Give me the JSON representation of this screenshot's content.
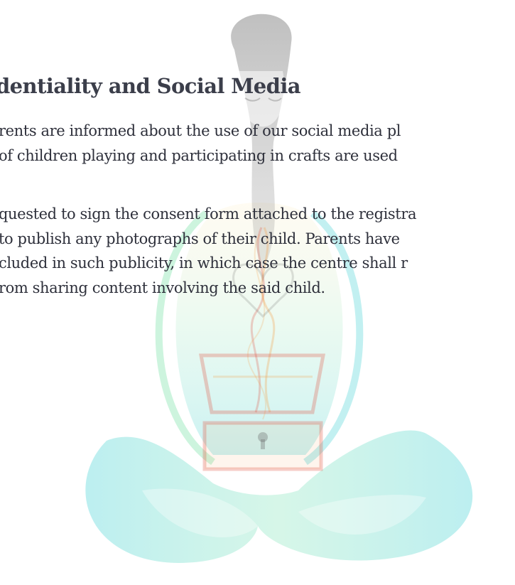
{
  "section": {
    "heading": "dentiality and Social Media",
    "paragraph1": {
      "lines": [
        "rents are informed about the use of our social media pl",
        "of children playing and participating in crafts are used"
      ]
    },
    "paragraph2": {
      "lines": [
        "quested to sign the consent form attached to the registra",
        " to publish any photographs of their child. Parents have",
        "cluded in such publicity, in which case the centre shall r",
        "rom sharing content involving the said child."
      ]
    }
  },
  "watermark": {
    "description_icon": "meditating-woman-with-locked-chest-logo",
    "colors": {
      "teal": "#4fd4d8",
      "green": "#6fe0a0",
      "orange": "#f4a04a",
      "red": "#e05a4a",
      "gray": "#6a6a6a"
    }
  }
}
